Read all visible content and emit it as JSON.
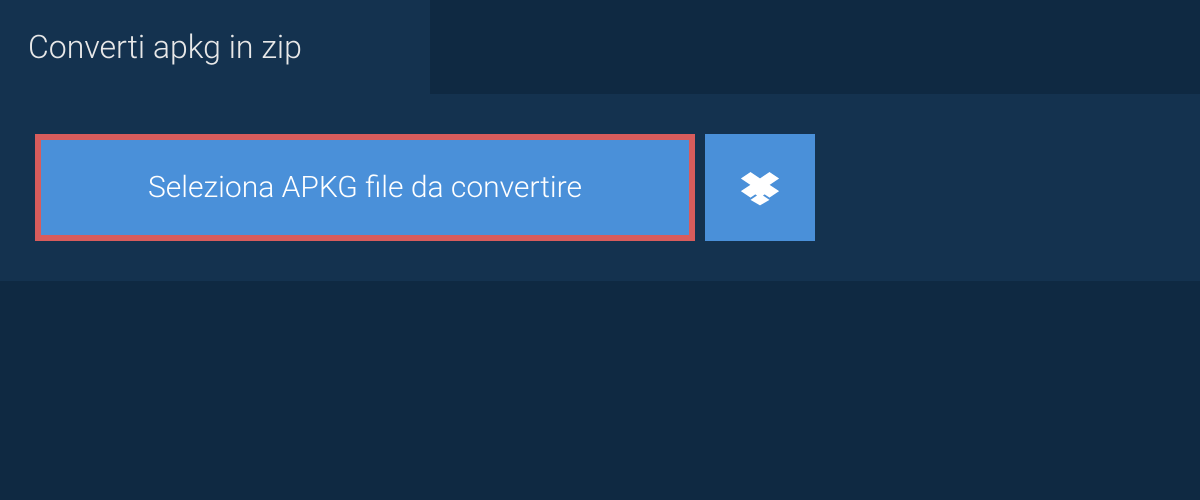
{
  "tab": {
    "label": "Converti apkg in zip"
  },
  "buttons": {
    "select_label": "Seleziona APKG file da convertire"
  },
  "colors": {
    "bg_dark": "#0f2942",
    "bg_panel": "#14324f",
    "button_blue": "#4a90d9",
    "border_red": "#d85c5c"
  }
}
